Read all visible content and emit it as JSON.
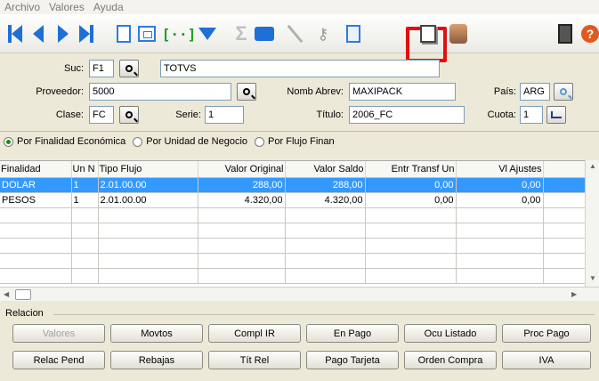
{
  "menu": [
    "Archivo",
    "Valores",
    "Ayuda"
  ],
  "toolbar": {
    "icons": [
      "first-record-icon",
      "previous-record-icon",
      "next-record-icon",
      "last-record-icon",
      "new-document-icon",
      "preview-icon",
      "brackets-icon",
      "filter-icon",
      "sum-icon",
      "print-icon",
      "line-icon",
      "key-icon",
      "search-document-icon",
      "book-icon",
      "person-icon",
      "exit-icon",
      "help-icon"
    ],
    "help_label": "?",
    "highlight_color": "#e01010"
  },
  "form": {
    "suc_label": "Suc:",
    "suc_value": "F1",
    "suc_name": "TOTVS",
    "proveedor_label": "Proveedor:",
    "proveedor_value": "5000",
    "nomb_label": "Nomb Abrev:",
    "nomb_value": "MAXIPACK",
    "pais_label": "País:",
    "pais_value": "ARG",
    "clase_label": "Clase:",
    "clase_value": "FC",
    "serie_label": "Serie:",
    "serie_value": "1",
    "titulo_label": "Título:",
    "titulo_value": "2006_FC",
    "cuota_label": "Cuota:",
    "cuota_value": "1"
  },
  "radios": [
    {
      "label": "Por Finalidad Económica",
      "checked": true
    },
    {
      "label": "Por Unidad de Negocio",
      "checked": false
    },
    {
      "label": "Por Flujo Finan",
      "checked": false
    }
  ],
  "table": {
    "columns": [
      "Finalidad",
      "Un N",
      "Tipo Flujo",
      "Valor Original",
      "Valor Saldo",
      "Entr Transf Un",
      "Vl Ajustes"
    ],
    "rows": [
      [
        "DOLAR",
        "1",
        "2.01.00.00",
        "288,00",
        "288,00",
        "0,00",
        "0,00"
      ],
      [
        "PESOS",
        "1",
        "2.01.00.00",
        "4.320,00",
        "4.320,00",
        "0,00",
        "0,00"
      ]
    ],
    "selected_row_color": "#3399ff"
  },
  "relacion": {
    "title": "Relacion",
    "buttons_row1": [
      "Valores",
      "Movtos",
      "Compl IR",
      "En Pago",
      "Ocu Listado",
      "Proc Pago"
    ],
    "buttons_row2": [
      "Relac Pend",
      "Rebajas",
      "Tít Rel",
      "Pago Tarjeta",
      "Orden Compra",
      "IVA"
    ]
  }
}
